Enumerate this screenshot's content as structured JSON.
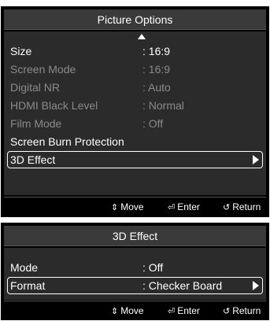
{
  "picture_options": {
    "title": "Picture Options",
    "items": [
      {
        "label": "Size",
        "value": ": 16:9",
        "enabled": true
      },
      {
        "label": "Screen Mode",
        "value": ": 16:9",
        "enabled": false
      },
      {
        "label": "Digital NR",
        "value": ": Auto",
        "enabled": false
      },
      {
        "label": "HDMI Black Level",
        "value": ": Normal",
        "enabled": false
      },
      {
        "label": "Film Mode",
        "value": ": Off",
        "enabled": false
      },
      {
        "label": "Screen Burn Protection",
        "value": "",
        "enabled": true
      },
      {
        "label": "3D Effect",
        "value": "",
        "enabled": true,
        "selected": true
      }
    ]
  },
  "three_d_effect": {
    "title": "3D Effect",
    "items": [
      {
        "label": "Mode",
        "value": ": Off"
      },
      {
        "label": "Format",
        "value": ": Checker Board",
        "selected": true
      }
    ]
  },
  "footer": {
    "move_label": "Move",
    "enter_label": "Enter",
    "return_label": "Return",
    "move_icon": "updown-arrows-icon",
    "enter_icon": "enter-icon",
    "return_icon": "return-icon"
  },
  "colors": {
    "panel_bg": "#000000",
    "body_bg": "#2b2b2b",
    "title_bg": "#3a3a3a",
    "text": "#ffffff",
    "disabled_text": "#8a8a8a"
  }
}
